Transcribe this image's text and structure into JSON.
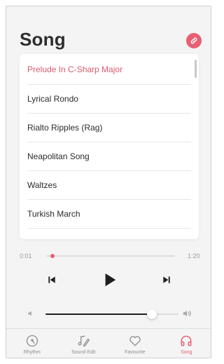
{
  "header": {
    "title": "Song"
  },
  "songs": [
    {
      "title": "Prelude In C-Sharp Major",
      "active": true
    },
    {
      "title": "Lyrical Rondo",
      "active": false
    },
    {
      "title": "Rialto Ripples (Rag)",
      "active": false
    },
    {
      "title": "Neapolitan Song",
      "active": false
    },
    {
      "title": "Waltzes",
      "active": false
    },
    {
      "title": "Turkish March",
      "active": false
    }
  ],
  "player": {
    "current_time": "0:01",
    "total_time": "1:20",
    "progress_fraction": 0.01,
    "volume_fraction": 0.8
  },
  "tabs": [
    {
      "label": "Rhythm",
      "icon": "metronome-icon",
      "active": false
    },
    {
      "label": "Sound Edit",
      "icon": "music-note-edit-icon",
      "active": false
    },
    {
      "label": "Favourite",
      "icon": "heart-icon",
      "active": false
    },
    {
      "label": "Song",
      "icon": "headphones-icon",
      "active": true
    }
  ],
  "colors": {
    "accent": "#e85f72",
    "active_text": "#d95a6d",
    "background": "#f4f4f5"
  }
}
